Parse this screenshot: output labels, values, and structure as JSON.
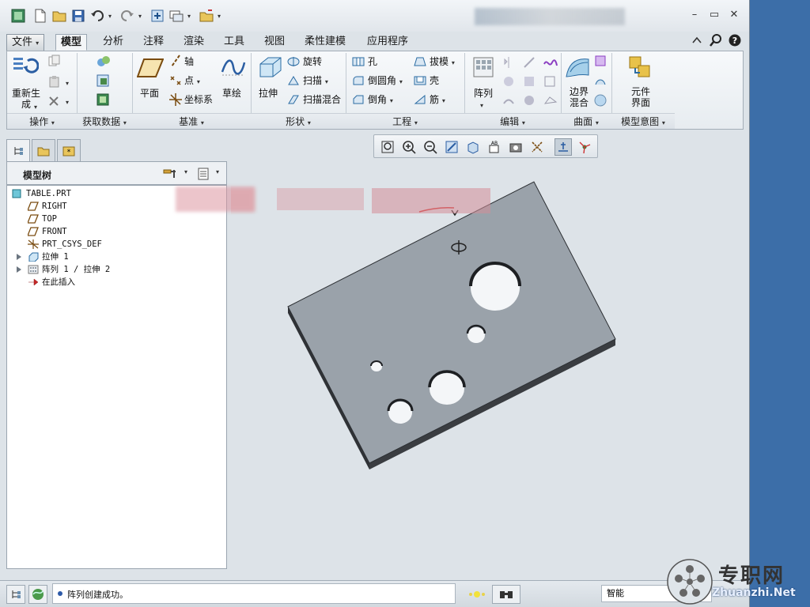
{
  "quick_access": [
    "app-icon",
    "new-icon",
    "open-icon",
    "save-icon",
    "undo-icon",
    "redo-icon",
    "regenerate-icon",
    "windows-icon",
    "close-window-icon",
    "customize-icon"
  ],
  "tabs": [
    {
      "label": "文件",
      "dropdown": "▾"
    },
    {
      "label": "模型"
    },
    {
      "label": "分析"
    },
    {
      "label": "注释"
    },
    {
      "label": "渲染"
    },
    {
      "label": "工具"
    },
    {
      "label": "视图"
    },
    {
      "label": "柔性建模"
    },
    {
      "label": "应用程序"
    }
  ],
  "ribbon": {
    "regenerate": "重新生\n成",
    "plane": "平面",
    "axis": "轴",
    "point": "点",
    "csys": "坐标系",
    "sketch": "草绘",
    "extrude": "拉伸",
    "revolve": "旋转",
    "sweep": "扫描",
    "swept_blend": "扫描混合",
    "hole": "孔",
    "round": "倒圆角",
    "chamfer": "倒角",
    "draft": "拔模",
    "shell": "壳",
    "rib": "筋",
    "pattern": "阵列",
    "boundary_blend": "边界\n混合",
    "component_interface": "元件\n界面",
    "groups": [
      "操作",
      "获取数据",
      "基准",
      "形状",
      "工程",
      "编辑",
      "曲面",
      "模型意图"
    ]
  },
  "model_tree": {
    "title": "模型树",
    "items": [
      {
        "label": "TABLE.PRT",
        "icon": "part-icon"
      },
      {
        "label": "RIGHT",
        "icon": "datum-plane-icon"
      },
      {
        "label": "TOP",
        "icon": "datum-plane-icon"
      },
      {
        "label": "FRONT",
        "icon": "datum-plane-icon"
      },
      {
        "label": "PRT_CSYS_DEF",
        "icon": "csys-icon"
      },
      {
        "label": "拉伸 1",
        "icon": "extrude-icon"
      },
      {
        "label": "阵列 1 / 拉伸 2",
        "icon": "pattern-icon"
      },
      {
        "label": "在此插入",
        "icon": "insert-here-icon"
      }
    ]
  },
  "status": {
    "message": "阵列创建成功。",
    "filter": "智能"
  },
  "watermark": {
    "title": "专职网",
    "url": "Zhuanzhi.Net"
  },
  "colors": {
    "accent": "#2d5aa8",
    "window_bg": "#dde3e8",
    "model_face": "#9aa2aa",
    "model_edge": "#2c2f33"
  }
}
